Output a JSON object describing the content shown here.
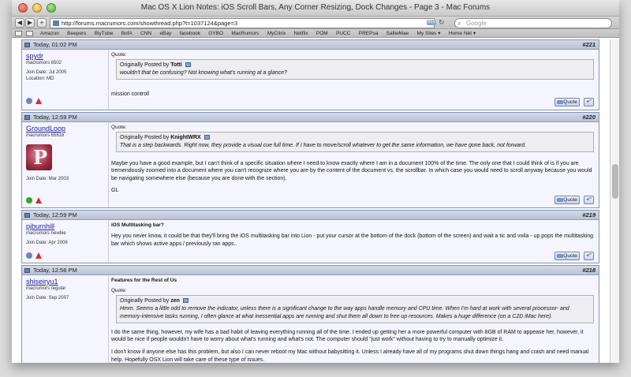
{
  "window": {
    "title": "Mac OS X Lion Notes: iOS Scroll Bars, Any Corner Resizing, Dock Changes - Page 3 - Mac Forums"
  },
  "toolbar": {
    "back": "◀",
    "forward": "▶",
    "add": "+",
    "url": "http://forums.macrumors.com/showthread.php?t=1037124&page=3",
    "rss": "RSS",
    "search_placeholder": "Google"
  },
  "bookmarks": [
    "Amazon",
    "Beepers",
    "BlyTube",
    "BofA",
    "CNN",
    "eBay",
    "facebook",
    "GYBO",
    "MacRumors",
    "MyCitrix",
    "Netflix",
    "POM",
    "PUCC",
    "PREPsa",
    "SallieMae",
    "My Sites ▾",
    "Home Net ▾"
  ],
  "posts": [
    {
      "date": "Today, 01:02 PM",
      "number": "221",
      "username": "spydr",
      "usertitle": "macrumors 6502",
      "join": "Join Date: Jul 2005",
      "location": "Location: MD",
      "quote_label": "Quote:",
      "quote_by": "Originally Posted by",
      "quote_author": "Totti",
      "quote_text": "wouldn't that be confusing? Not knowing what's running at a glance?",
      "body": "mission control!",
      "quote_btn": "Quote",
      "multi_btn": "+\""
    },
    {
      "date": "Today, 12:59 PM",
      "number": "220",
      "username": "GroundLoop",
      "usertitle": "macrumors 65816",
      "join": "Join Date: Mar 2003",
      "quote_label": "Quote:",
      "quote_by": "Originally Posted by",
      "quote_author": "KnightWRX",
      "quote_text": "That is a step backwards. Right now, they provide a visual cue full time. If I have to move/scroll whatever to get the same information, we have gone back, not forward.",
      "body1": "Maybe you have a good example, but I can't think of a specific situation where I need to know exactly where I am in a document 100% of the time. The only one that I could think of is if you are tremendously zoomed into a document where you can't recognize where you are by the content of the document vs. the scrollbar. In which case you would need to scroll anyway because you would be navigating somewhere else (because you are done with the section).",
      "body2": "GL",
      "quote_btn": "Quote",
      "multi_btn": "+\""
    },
    {
      "date": "Today, 12:59 PM",
      "number": "219",
      "username": "pjburnhill",
      "usertitle": "macrumors newbie",
      "join": "Join Date: Apr 2006",
      "post_title": "iOS Multitasking bar?",
      "body": "Hey you never know, it could be that they'll bring the iOS multitasking bar into Lion - put your cursor at the bottom of the dock (bottom of the screen) and wait a tic and voila - up pops the multitasking bar which shows active apps / previously ran apps..",
      "quote_btn": "Quote",
      "multi_btn": "+\""
    },
    {
      "date": "Today, 12:58 PM",
      "number": "218",
      "username": "shiseiryu1",
      "usertitle": "macrumors regular",
      "join": "Join Date: Sep 2007",
      "post_title": "Features for the Rest of Us",
      "quote_label": "Quote:",
      "quote_by": "Originally Posted by",
      "quote_author": "zen",
      "quote_text": "Hmm. Seems a little odd to remove the indicator, unless there is a significant change to the way apps handle memory and CPU time. When I'm hard at work with several processor- and memory-intensive tasks running, I often glance at what inessential apps are running and shut them all down to free up resources. Makes a huge difference (on a C2D iMac here).",
      "body1": "I do the same thing, however, my wife has a bad habit of leaving everything running all of the time. I ended up getting her a more powerful computer with 8GB of RAM to appease her, however, it would be nice if people wouldn't have to worry about what's running and what's not. The computer should \"just work\" without having to try to manually optimize it.",
      "body2": "I don't know if anyone else has this problem, but also I can never reboot my Mac without babysitting it. Unless I already have all of my programs shut down things hang and crash and need manual help. Hopefully OSX Lion will take care of these type of issues."
    }
  ]
}
